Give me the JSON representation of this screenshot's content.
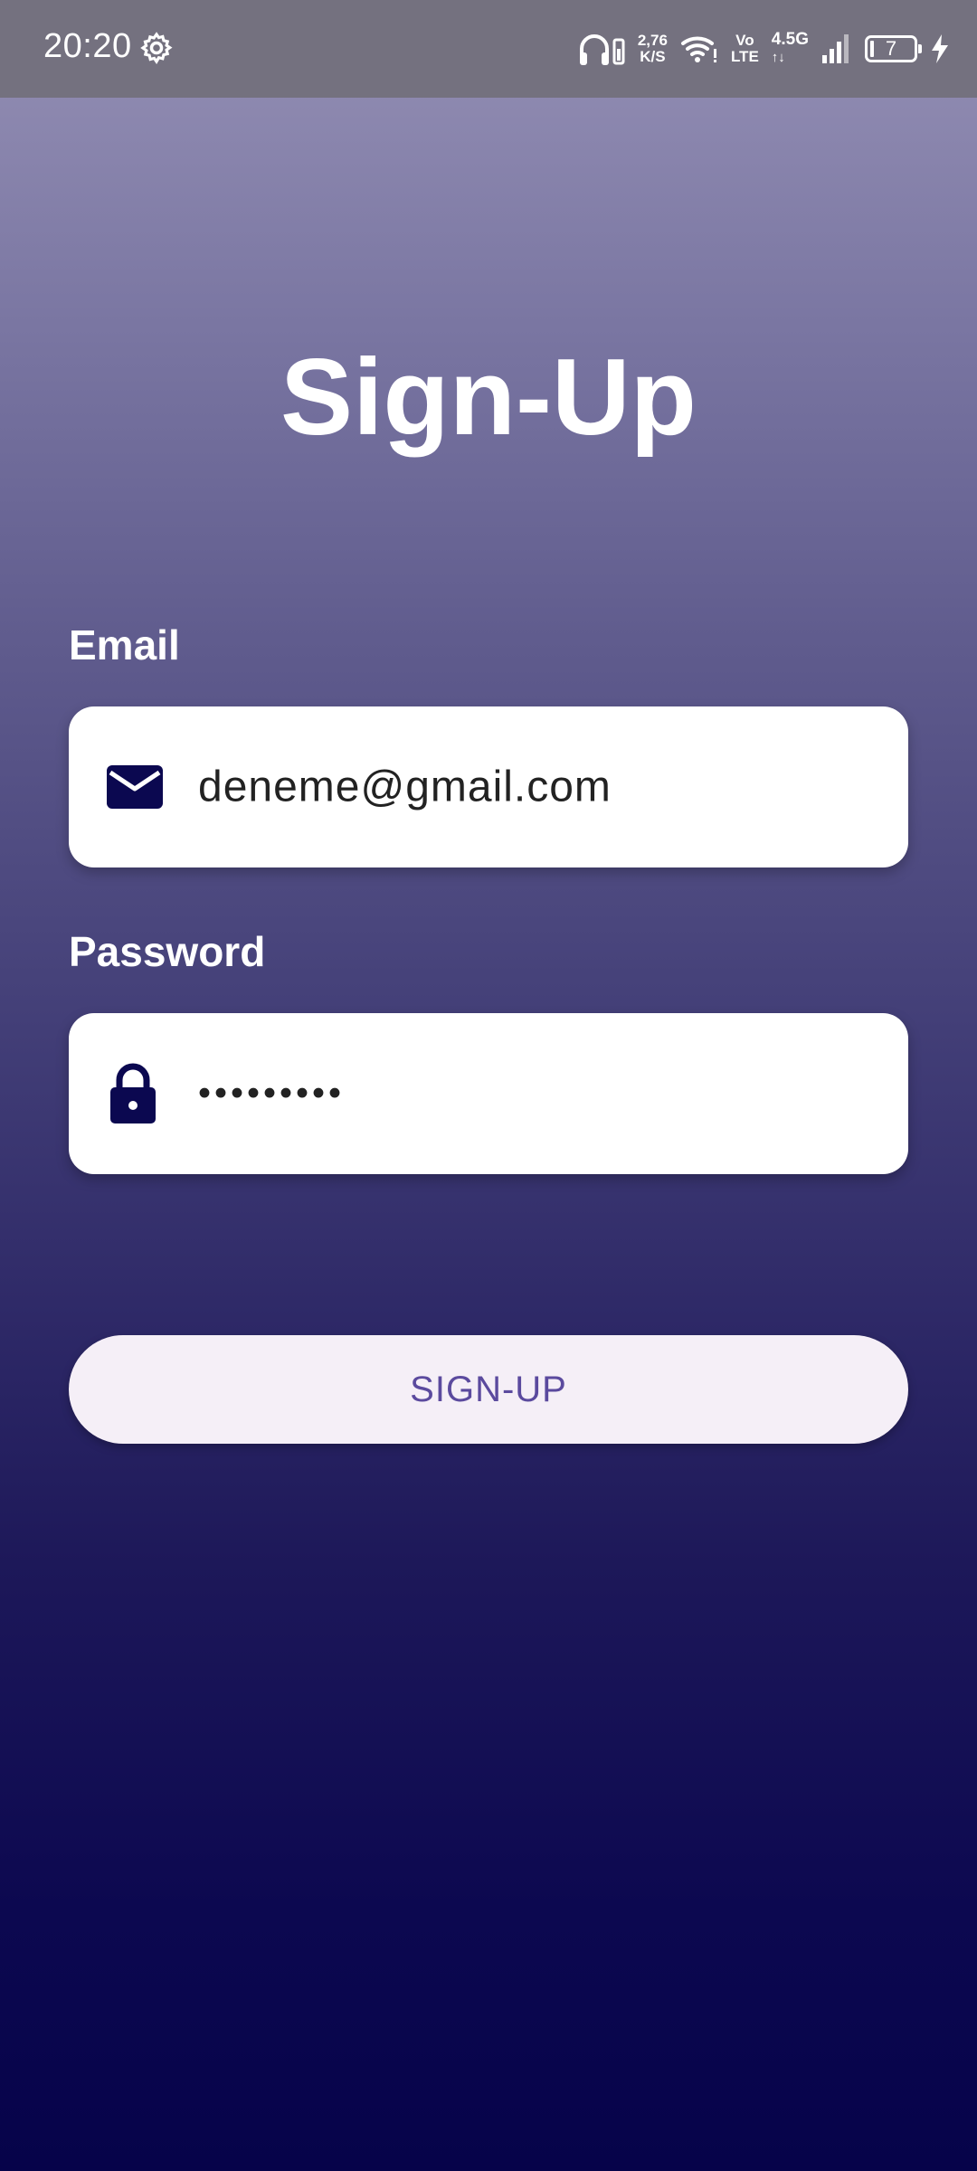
{
  "status_bar": {
    "time": "20:20",
    "net_speed_value": "2,76",
    "net_speed_unit": "K/S",
    "volte_top": "Vo",
    "volte_bottom": "LTE",
    "network_type": "4.5G",
    "network_arrows": "↑↓",
    "battery_level": "7"
  },
  "page": {
    "title": "Sign-Up"
  },
  "form": {
    "email_label": "Email",
    "email_value": "deneme@gmail.com",
    "password_label": "Password",
    "password_value": "•••••••••",
    "submit_label": "SIGN-UP"
  },
  "colors": {
    "icon_color": "#0b0850",
    "button_text": "#5b4a9e",
    "button_bg": "#f5eff7"
  }
}
